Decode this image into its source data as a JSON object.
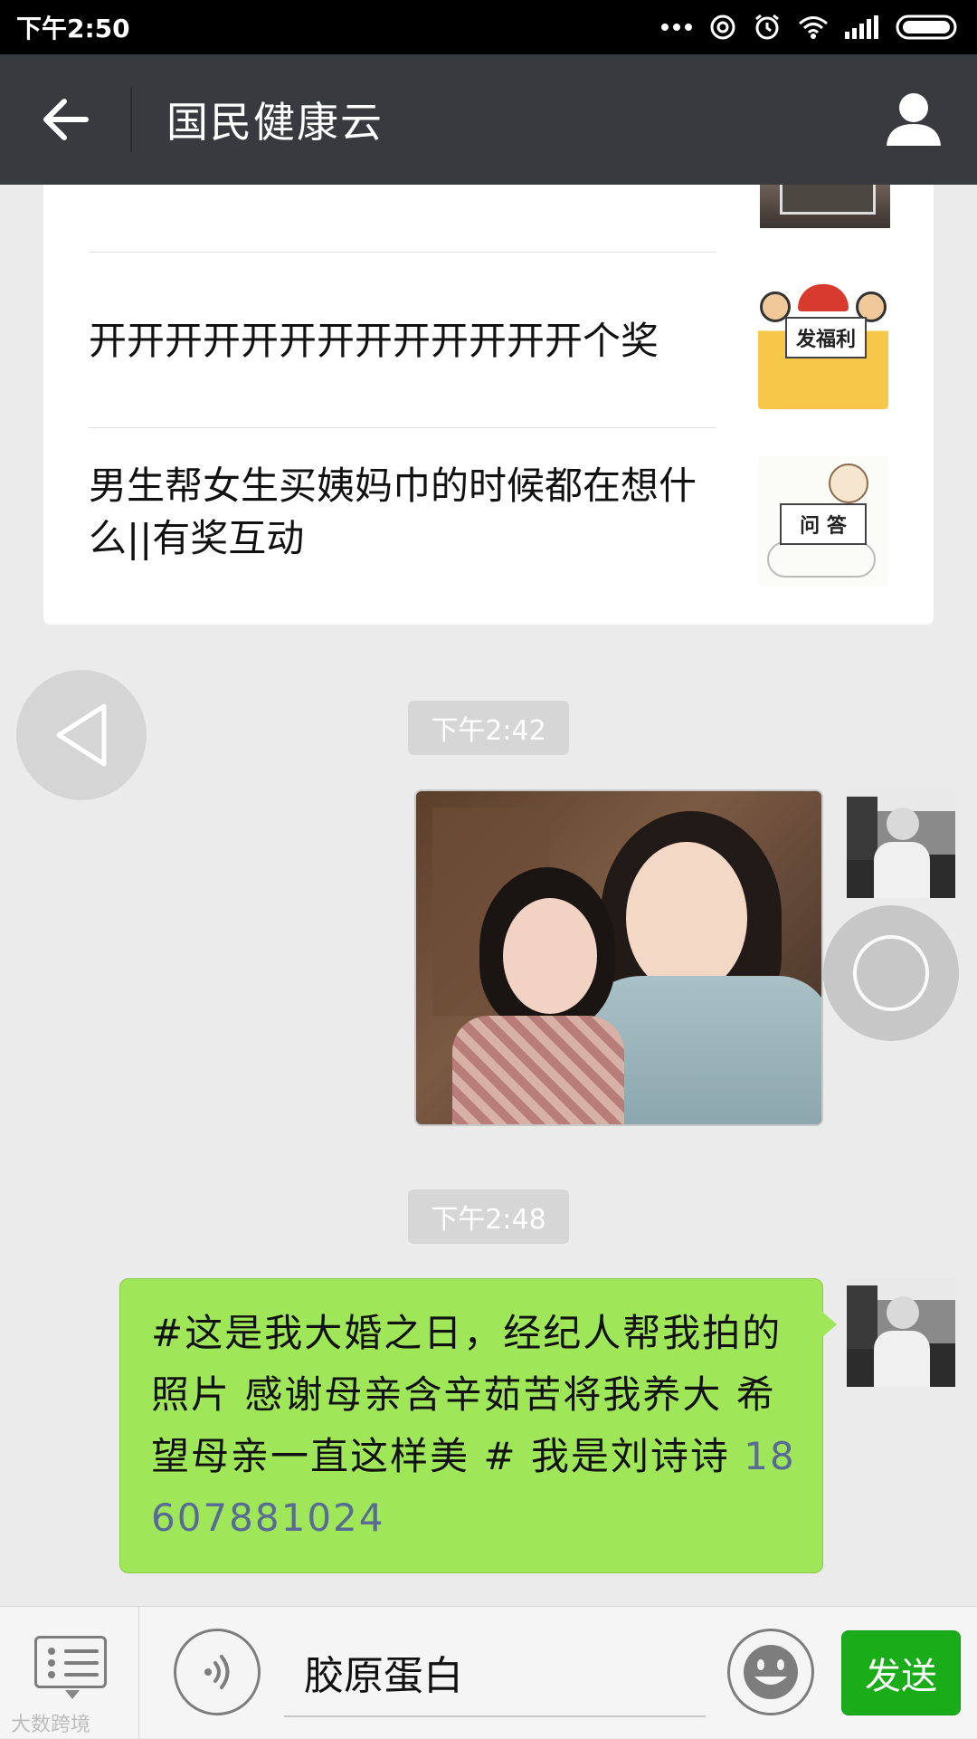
{
  "status_bar": {
    "time": "下午2:50",
    "icons": [
      "more-dots-icon",
      "signal-ring-icon",
      "alarm-icon",
      "wifi-icon",
      "cell-signal-icon",
      "battery-icon"
    ]
  },
  "header": {
    "title": "国民健康云",
    "back_icon": "back-arrow-icon",
    "profile_icon": "person-icon"
  },
  "article_card": {
    "items": [
      {
        "title": "开开开开开开开开开开开开开个奖",
        "thumbnail_label": "发福利"
      },
      {
        "title": "男生帮女生买姨妈巾的时候都在想什么||有奖互动",
        "thumbnail_label": "问 答"
      }
    ]
  },
  "messages": [
    {
      "timestamp": "下午2:42",
      "type": "image",
      "sender": "self"
    },
    {
      "timestamp": "下午2:48",
      "type": "text",
      "sender": "self",
      "text": "#这是我大婚之日，经纪人帮我拍的照片 感谢母亲含辛茹苦将我养大 希望母亲一直这样美 # 我是刘诗诗 ",
      "phone": "18607881024"
    }
  ],
  "input_bar": {
    "menu_icon": "menu-list-icon",
    "voice_icon": "voice-icon",
    "input_value": "胶原蛋白",
    "emoji_icon": "emoji-icon",
    "send_label": "发送",
    "watermark": "大数跨境"
  },
  "colors": {
    "nav_bg": "#393a3f",
    "chat_bg": "#ebebeb",
    "bubble_green": "#9fe658",
    "send_green": "#1aad19",
    "link_blue": "#576b95"
  }
}
